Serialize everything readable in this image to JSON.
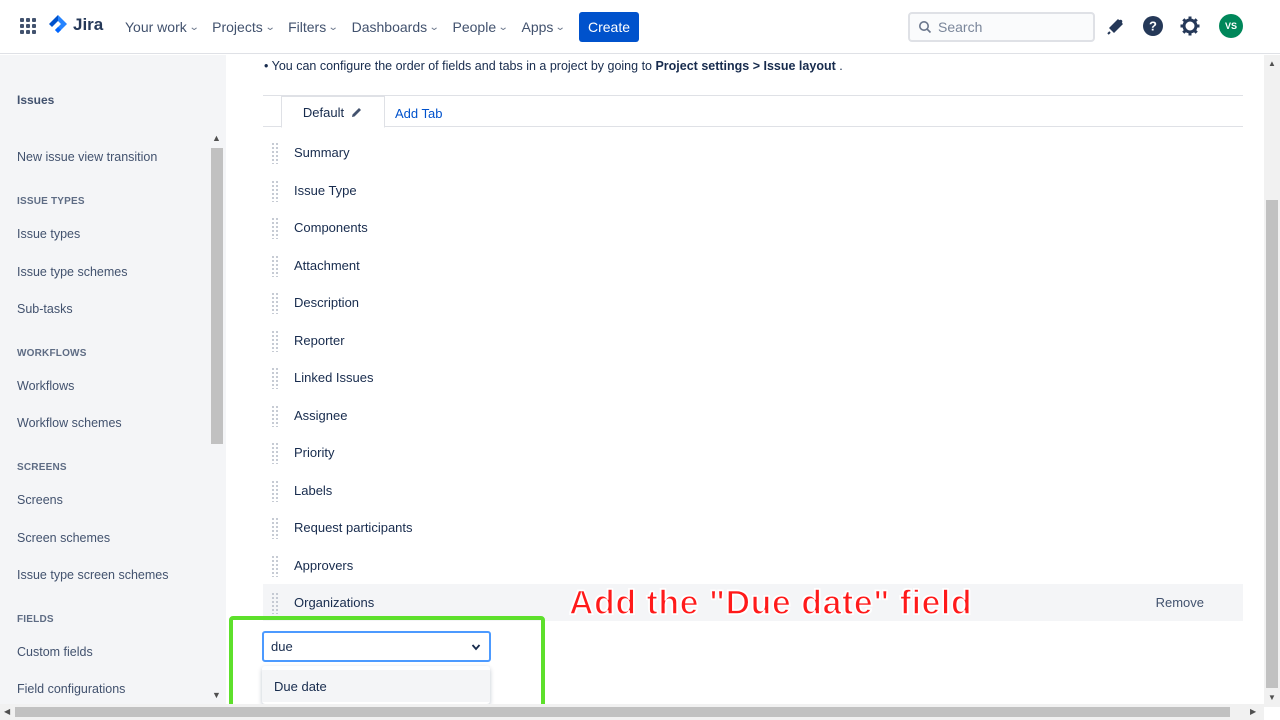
{
  "topnav": {
    "logo_text": "Jira",
    "items": [
      {
        "label": "Your work"
      },
      {
        "label": "Projects"
      },
      {
        "label": "Filters"
      },
      {
        "label": "Dashboards"
      },
      {
        "label": "People"
      },
      {
        "label": "Apps"
      }
    ],
    "create_label": "Create",
    "search_placeholder": "Search",
    "avatar_initials": "VS",
    "brand_color": "#0052cc",
    "avatar_color": "#00875a"
  },
  "sidebar": {
    "title": "Issues",
    "items": [
      {
        "type": "item",
        "label": "New issue view transition"
      },
      {
        "type": "head",
        "label": "ISSUE TYPES"
      },
      {
        "type": "item",
        "label": "Issue types"
      },
      {
        "type": "item",
        "label": "Issue type schemes"
      },
      {
        "type": "item",
        "label": "Sub-tasks"
      },
      {
        "type": "head",
        "label": "WORKFLOWS"
      },
      {
        "type": "item",
        "label": "Workflows"
      },
      {
        "type": "item",
        "label": "Workflow schemes"
      },
      {
        "type": "head",
        "label": "SCREENS"
      },
      {
        "type": "item",
        "label": "Screens"
      },
      {
        "type": "item",
        "label": "Screen schemes"
      },
      {
        "type": "item",
        "label": "Issue type screen schemes"
      },
      {
        "type": "head",
        "label": "FIELDS"
      },
      {
        "type": "item",
        "label": "Custom fields"
      },
      {
        "type": "item",
        "label": "Field configurations"
      }
    ]
  },
  "main": {
    "info": {
      "prefix": "You can configure the order of fields and tabs in a project by going to ",
      "bold1": "Project settings",
      "sep": " > ",
      "bold2": "Issue layout",
      "suffix": " ."
    },
    "tabs": {
      "default_label": "Default",
      "add_tab_label": "Add Tab"
    },
    "fields": [
      "Summary",
      "Issue Type",
      "Components",
      "Attachment",
      "Description",
      "Reporter",
      "Linked Issues",
      "Assignee",
      "Priority",
      "Labels",
      "Request participants",
      "Approvers",
      "Organizations"
    ],
    "remove_label": "Remove",
    "field_select": {
      "value": "due",
      "option": "Due date"
    }
  },
  "annotation": {
    "text": "Add the \"Due date\" field",
    "color": "#ff1a1a",
    "highlight_color": "#5de02b"
  }
}
